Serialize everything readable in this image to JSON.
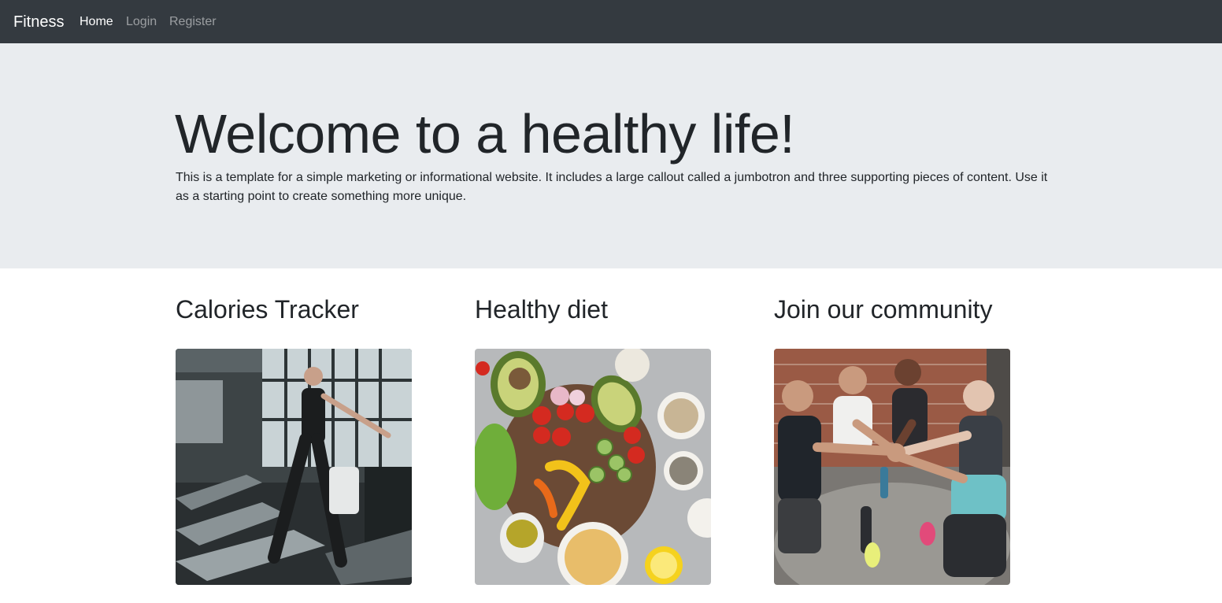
{
  "navbar": {
    "brand": "Fitness",
    "links": [
      {
        "label": "Home",
        "active": true
      },
      {
        "label": "Login",
        "active": false
      },
      {
        "label": "Register",
        "active": false
      }
    ]
  },
  "jumbotron": {
    "title": "Welcome to a healthy life!",
    "lead": "This is a template for a simple marketing or informational website. It includes a large callout called a jumbotron and three supporting pieces of content. Use it as a starting point to create something more unique."
  },
  "features": [
    {
      "title": "Calories Tracker",
      "image": "woman-on-treadmill-photo"
    },
    {
      "title": "Healthy diet",
      "image": "healthy-food-flatlay-photo"
    },
    {
      "title": "Join our community",
      "image": "group-fist-bump-photo"
    }
  ],
  "colors": {
    "navbar_bg": "#343a40",
    "jumbotron_bg": "#e9ecef",
    "text": "#212529"
  }
}
